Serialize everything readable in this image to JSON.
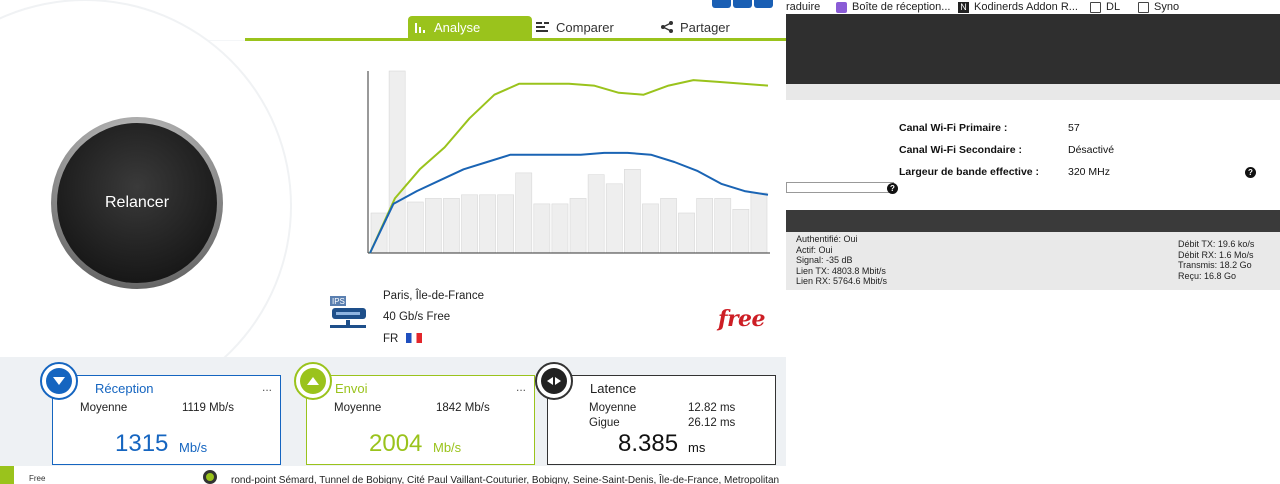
{
  "background_page": {
    "bookmarks": [
      {
        "label": "raduire",
        "icon": "none"
      },
      {
        "label": "Boîte de réception...",
        "icon": "mail-icon"
      },
      {
        "label": "Kodinerds Addon R...",
        "icon": "kodinerds-icon"
      },
      {
        "label": "DL",
        "icon": "folder-icon"
      },
      {
        "label": "Syno",
        "icon": "folder-icon"
      }
    ],
    "wifi": [
      {
        "label": "Canal Wi-Fi Primaire :",
        "value": "57"
      },
      {
        "label": "Canal Wi-Fi Secondaire :",
        "value": "Désactivé"
      },
      {
        "label": "Largeur de bande effective :",
        "value": "320 MHz"
      }
    ],
    "help_glyph": "?",
    "stats_left": [
      "Authentifié: Oui",
      "Actif: Oui",
      "Signal: -35 dB",
      "Lien TX: 4803.8 Mbit/s",
      "Lien RX: 5764.6 Mbit/s"
    ],
    "stats_right": [
      "Débit TX: 19.6 ko/s",
      "Débit RX: 1.6 Mo/s",
      "Transmis: 18.2 Go",
      "Reçu: 16.8 Go"
    ]
  },
  "speedtest": {
    "tabs": [
      {
        "label": "Analyse",
        "icon": "bar-chart-icon",
        "active": true
      },
      {
        "label": "Comparer",
        "icon": "compare-icon",
        "active": false
      },
      {
        "label": "Partager",
        "icon": "share-icon",
        "active": false
      }
    ],
    "relaunch_label": "Relancer",
    "server": {
      "icon_label": "IPS",
      "location": "Paris, Île-de-France",
      "plan": "40 Gb/s Free",
      "country": "FR"
    },
    "provider_logo": "free",
    "cards": {
      "reception": {
        "title": "Réception",
        "more": "...",
        "avg_label": "Moyenne",
        "avg_value": "1119 Mb/s",
        "big": "1315",
        "unit": "Mb/s"
      },
      "envoi": {
        "title": "Envoi",
        "more": "...",
        "avg_label": "Moyenne",
        "avg_value": "1842 Mb/s",
        "big": "2004",
        "unit": "Mb/s"
      },
      "latence": {
        "title": "Latence",
        "avg_label": "Moyenne",
        "avg_value": "12.82 ms",
        "jitter_label": "Gigue",
        "jitter_value": "26.12 ms",
        "big": "8.385",
        "unit": "ms"
      }
    },
    "footer": {
      "isp_label": "Free",
      "address": "rond-point Sémard, Tunnel de Bobigny, Cité Paul Vaillant-Couturier, Bobigny, Seine-Saint-Denis, Île-de-France, Metropolitan"
    },
    "colors": {
      "green": "#9ac31c",
      "blue": "#1565c0",
      "free_red": "#cd1e25"
    }
  },
  "chart_data": {
    "type": "line",
    "x_count": 21,
    "bars": [
      0.22,
      1.0,
      0.28,
      0.3,
      0.3,
      0.32,
      0.32,
      0.32,
      0.44,
      0.27,
      0.27,
      0.3,
      0.43,
      0.38,
      0.46,
      0.27,
      0.3,
      0.22,
      0.3,
      0.3,
      0.24,
      0.33
    ],
    "series": [
      {
        "values": [
          0.0,
          0.3,
          0.46,
          0.58,
          0.74,
          0.87,
          0.93,
          0.93,
          0.93,
          0.92,
          0.88,
          0.87,
          0.92,
          0.95,
          0.94,
          0.93,
          0.92
        ],
        "color": "#9ac31c"
      },
      {
        "values": [
          0.0,
          0.27,
          0.34,
          0.4,
          0.46,
          0.5,
          0.54,
          0.54,
          0.54,
          0.54,
          0.55,
          0.55,
          0.54,
          0.5,
          0.45,
          0.38,
          0.34,
          0.32
        ],
        "color": "#1a64b4"
      }
    ]
  }
}
